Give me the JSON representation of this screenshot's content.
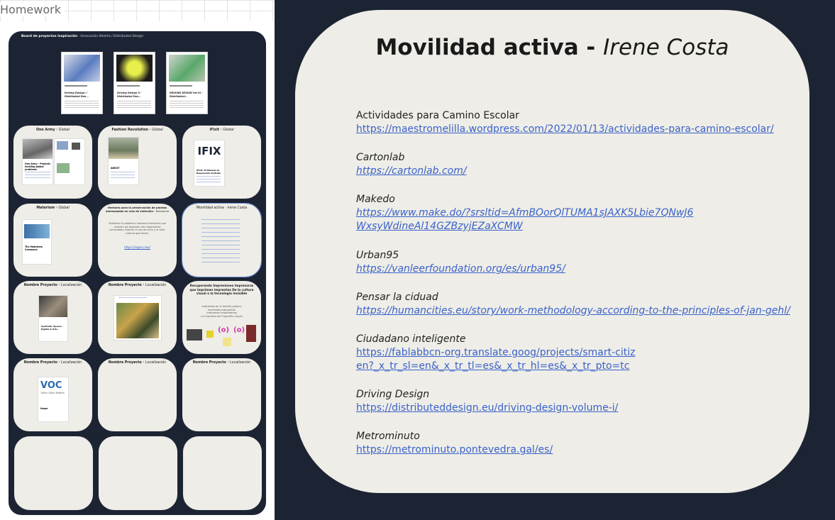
{
  "left_panel": {
    "header": "Homework",
    "board_title": "Board de proyectos inspiración",
    "board_subtitle": "· Innovación Abierta / Distributed Design",
    "docs": [
      {
        "title": "Driving Design I - Distributed Des...",
        "color": "#5a7cc0"
      },
      {
        "title": "Driving Design II - Distributed Des...",
        "color": "#d9df3a"
      },
      {
        "title": "DRIVING DESIGN Vol III - Distributed...",
        "color": "#59a86a"
      }
    ],
    "cards": [
      {
        "name": "One Army",
        "loc": "Global",
        "mini_title": "One Army - Projects tackling global problems"
      },
      {
        "name": "Fashion Revolution",
        "loc": "Global",
        "mini_title": "ABOUT"
      },
      {
        "name": "iFixit",
        "loc": "Global",
        "mini_title": "iFixit: El Manual de Reparación Gratuito",
        "logo": "IFIX"
      },
      {
        "name": "Materiom",
        "loc": "Global",
        "mini_title": "The Materiom Commons"
      },
      {
        "name": "Herbario para la preservación de plantas amenazadas en vías de extinción",
        "loc": "Barcelona",
        "body": "Visibilizar el problema: herbario interactivo que muestra las especies más importantes vulnerables. Explicar el uso de entre y el valor cultural que tienen.",
        "link": "https://regen.now/"
      },
      {
        "name": "Movilidad activa",
        "loc": "Irene Costa"
      },
      {
        "name": "Nombre Proyecto",
        "loc": "Localización",
        "mini_title": "Synthetic Spaces - Digital & Urb..."
      },
      {
        "name": "Nombre Proyecto",
        "loc": "Localización"
      },
      {
        "name": "Recuperando Impresiones Impresoras que imprimen imprentas De la cultura visual a la tecnología invisible",
        "loc": "",
        "body": "Imprentas en el ámbito público\nImprentas educativas\nImprentas hospitalarias\nLa imprenta del Frigorífico Anglo"
      },
      {
        "name": "Nombre Proyecto",
        "loc": "Localización",
        "mini_title": "Home",
        "logo": "VOC"
      },
      {
        "name": "Nombre Proyecto",
        "loc": "Localización"
      },
      {
        "name": "Nombre Proyecto",
        "loc": "Localización"
      }
    ],
    "voc_caption": "Tiktun Olam Makers"
  },
  "slide": {
    "title": "Movilidad activa - ",
    "author": "Irene Costa",
    "entries": [
      {
        "label": "Actividades para Camino Escolar",
        "url": "https://maestromelilla.wordpress.com/2022/01/13/actividades-para-camino-escolar/"
      },
      {
        "label": "Cartonlab",
        "url": "https://cartonlab.com/"
      },
      {
        "label": "Makedo",
        "url": "https://www.make.do/?srsltid=AfmBOorQlTUMA1sJAXK5Lbie7QNwJ6WxsyWdineAl14GZBzyjEZaXCMW"
      },
      {
        "label": "Urban95",
        "url": "https://vanleerfoundation.org/es/urban95/"
      },
      {
        "label": "Pensar la ciduad",
        "url": "https://humancities.eu/story/work-methodology-according-to-the-principles-of-jan-gehl/"
      },
      {
        "label": "Ciudadano inteligente",
        "url": "https://fablabbcn-org.translate.goog/projects/smart-citizen?_x_tr_sl=en&_x_tr_tl=es&_x_tr_hl=es&_x_tr_pto=tc"
      },
      {
        "label": "Driving Design",
        "url": "https://distributeddesign.eu/driving-design-volume-i/"
      },
      {
        "label": "Metrominuto",
        "url": "https://metrominuto.pontevedra.gal/es/"
      }
    ]
  },
  "colors": {
    "board_bg": "#1c2434",
    "card_bg": "#eeede7",
    "link": "#3a62c9"
  }
}
